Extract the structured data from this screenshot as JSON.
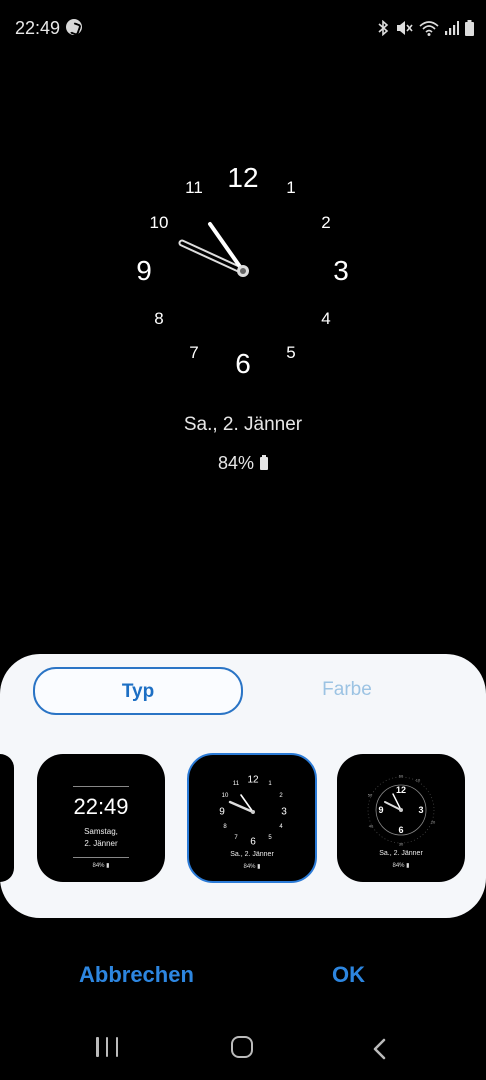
{
  "status_bar": {
    "time": "22:49",
    "icons": [
      "shazam-icon",
      "bluetooth-icon",
      "mute-icon",
      "wifi-icon",
      "signal-icon",
      "battery-icon"
    ]
  },
  "clock_preview": {
    "numerals": [
      "12",
      "1",
      "2",
      "3",
      "4",
      "5",
      "6",
      "7",
      "8",
      "9",
      "10",
      "11"
    ],
    "time_shown": "22:49",
    "date": "Sa., 2. Jänner",
    "battery": "84%"
  },
  "tabs": {
    "typ": "Typ",
    "farbe": "Farbe",
    "selected": "Typ",
    "accent_color": "#2a74c5"
  },
  "styles": {
    "digital": {
      "time": "22:49",
      "date_line1": "Samstag,",
      "date_line2": "2. Jänner",
      "battery": "84%"
    },
    "analog": {
      "numerals": [
        "12",
        "1",
        "2",
        "3",
        "4",
        "5",
        "6",
        "7",
        "8",
        "9",
        "10",
        "11"
      ],
      "date": "Sa., 2. Jänner",
      "battery": "84%",
      "selected": true
    },
    "sport": {
      "numerals": [
        "12",
        "3",
        "6",
        "9"
      ],
      "ticks": [
        "10",
        "20",
        "30",
        "40",
        "50",
        "60"
      ],
      "date": "Sa., 2. Jänner",
      "battery": "84%"
    }
  },
  "actions": {
    "cancel": "Abbrechen",
    "ok": "OK",
    "color": "#2d86e0"
  },
  "nav": {
    "icons": [
      "recent-apps-icon",
      "home-icon",
      "back-icon"
    ]
  }
}
